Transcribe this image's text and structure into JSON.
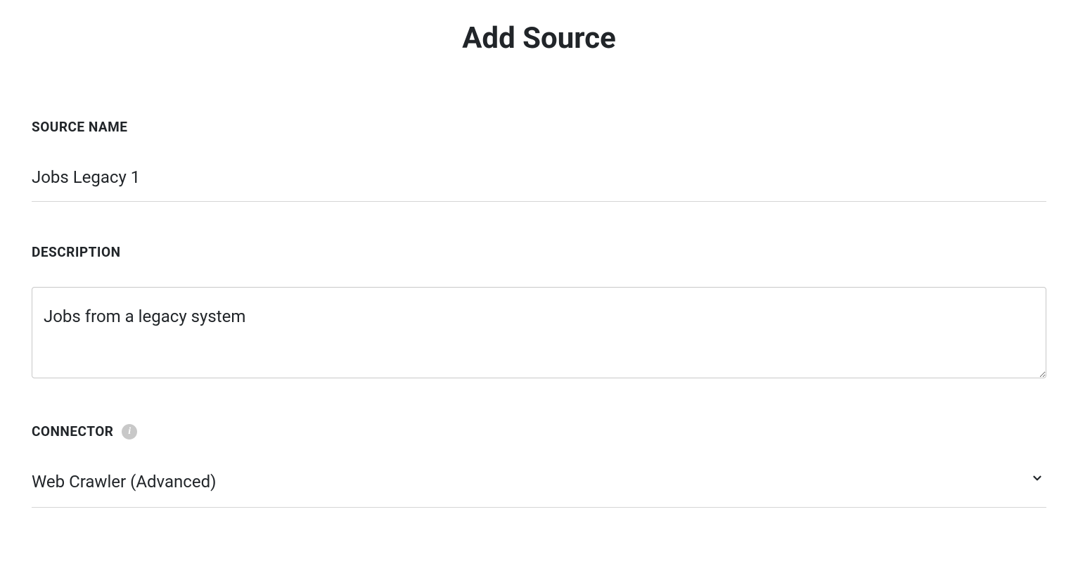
{
  "page": {
    "title": "Add Source"
  },
  "fields": {
    "source_name": {
      "label": "SOURCE NAME",
      "value": "Jobs Legacy 1"
    },
    "description": {
      "label": "DESCRIPTION",
      "value": "Jobs from a legacy system"
    },
    "connector": {
      "label": "CONNECTOR",
      "selected": "Web Crawler (Advanced)"
    }
  }
}
